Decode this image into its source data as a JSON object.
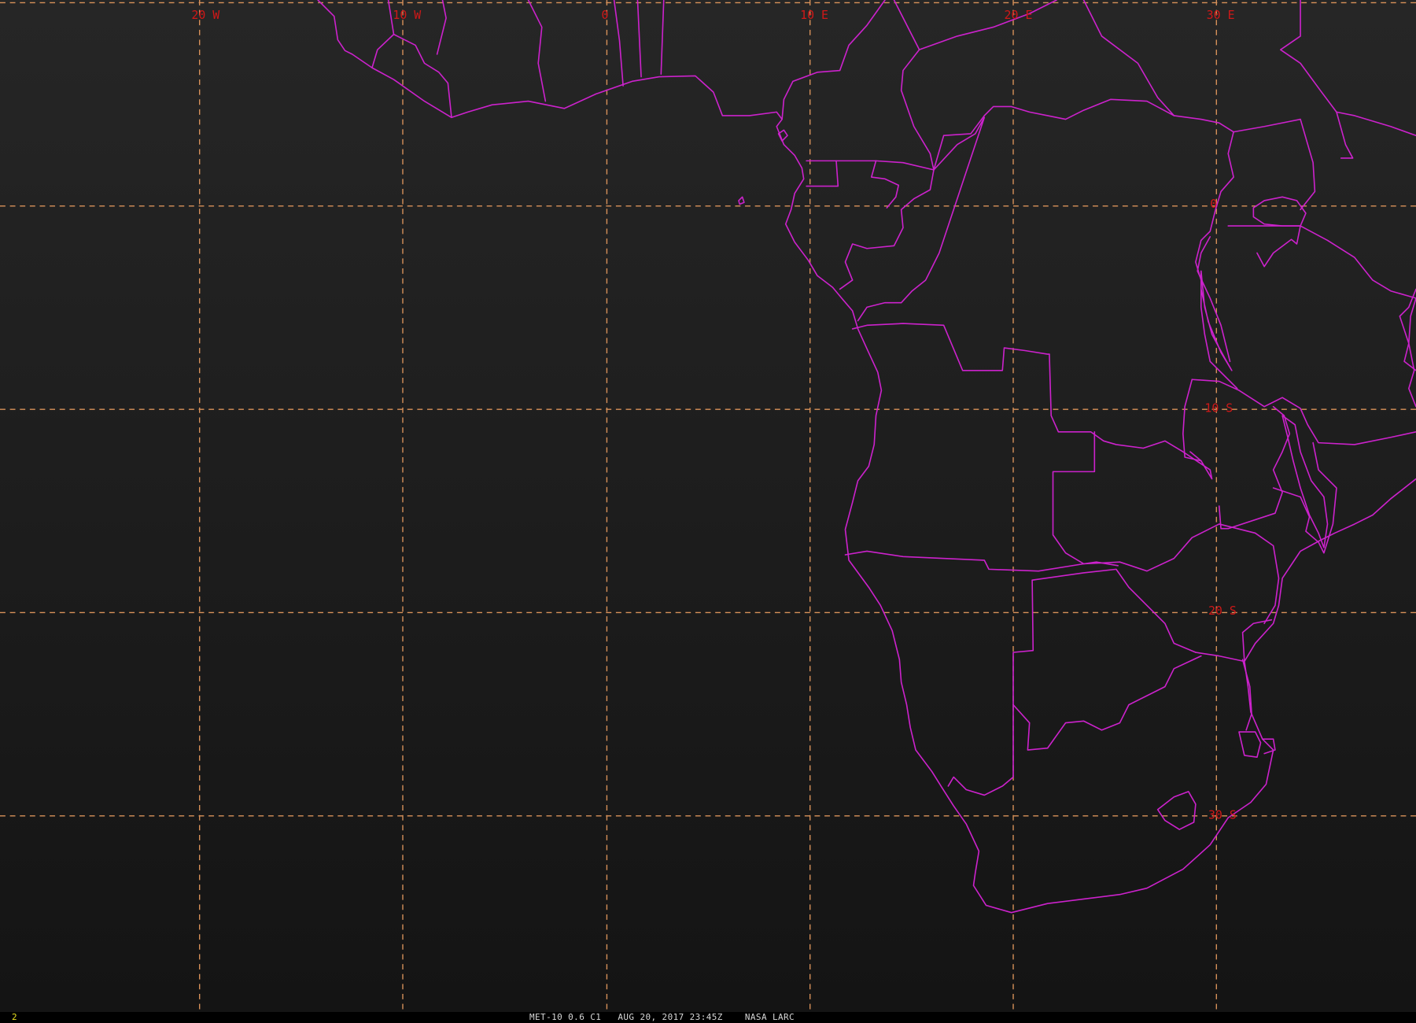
{
  "colors": {
    "background_top": "#262626",
    "background_bottom": "#141414",
    "borders": "#cc22cc",
    "graticule": "#d9925a",
    "grid_labels": "#d01818",
    "caption_text": "#d8d8d8",
    "frame_number": "#e8e020"
  },
  "graticule": {
    "longitude_labels": [
      "20 W",
      "10 W",
      "0",
      "10 E",
      "20 E",
      "30 E"
    ],
    "latitude_labels": [
      "0",
      "10 S",
      "20 S",
      "30 S"
    ]
  },
  "status_bar": {
    "frame_number": "2",
    "caption": "MET-10 0.6 C1   AUG 20, 2017 23:45Z    NASA LARC"
  }
}
